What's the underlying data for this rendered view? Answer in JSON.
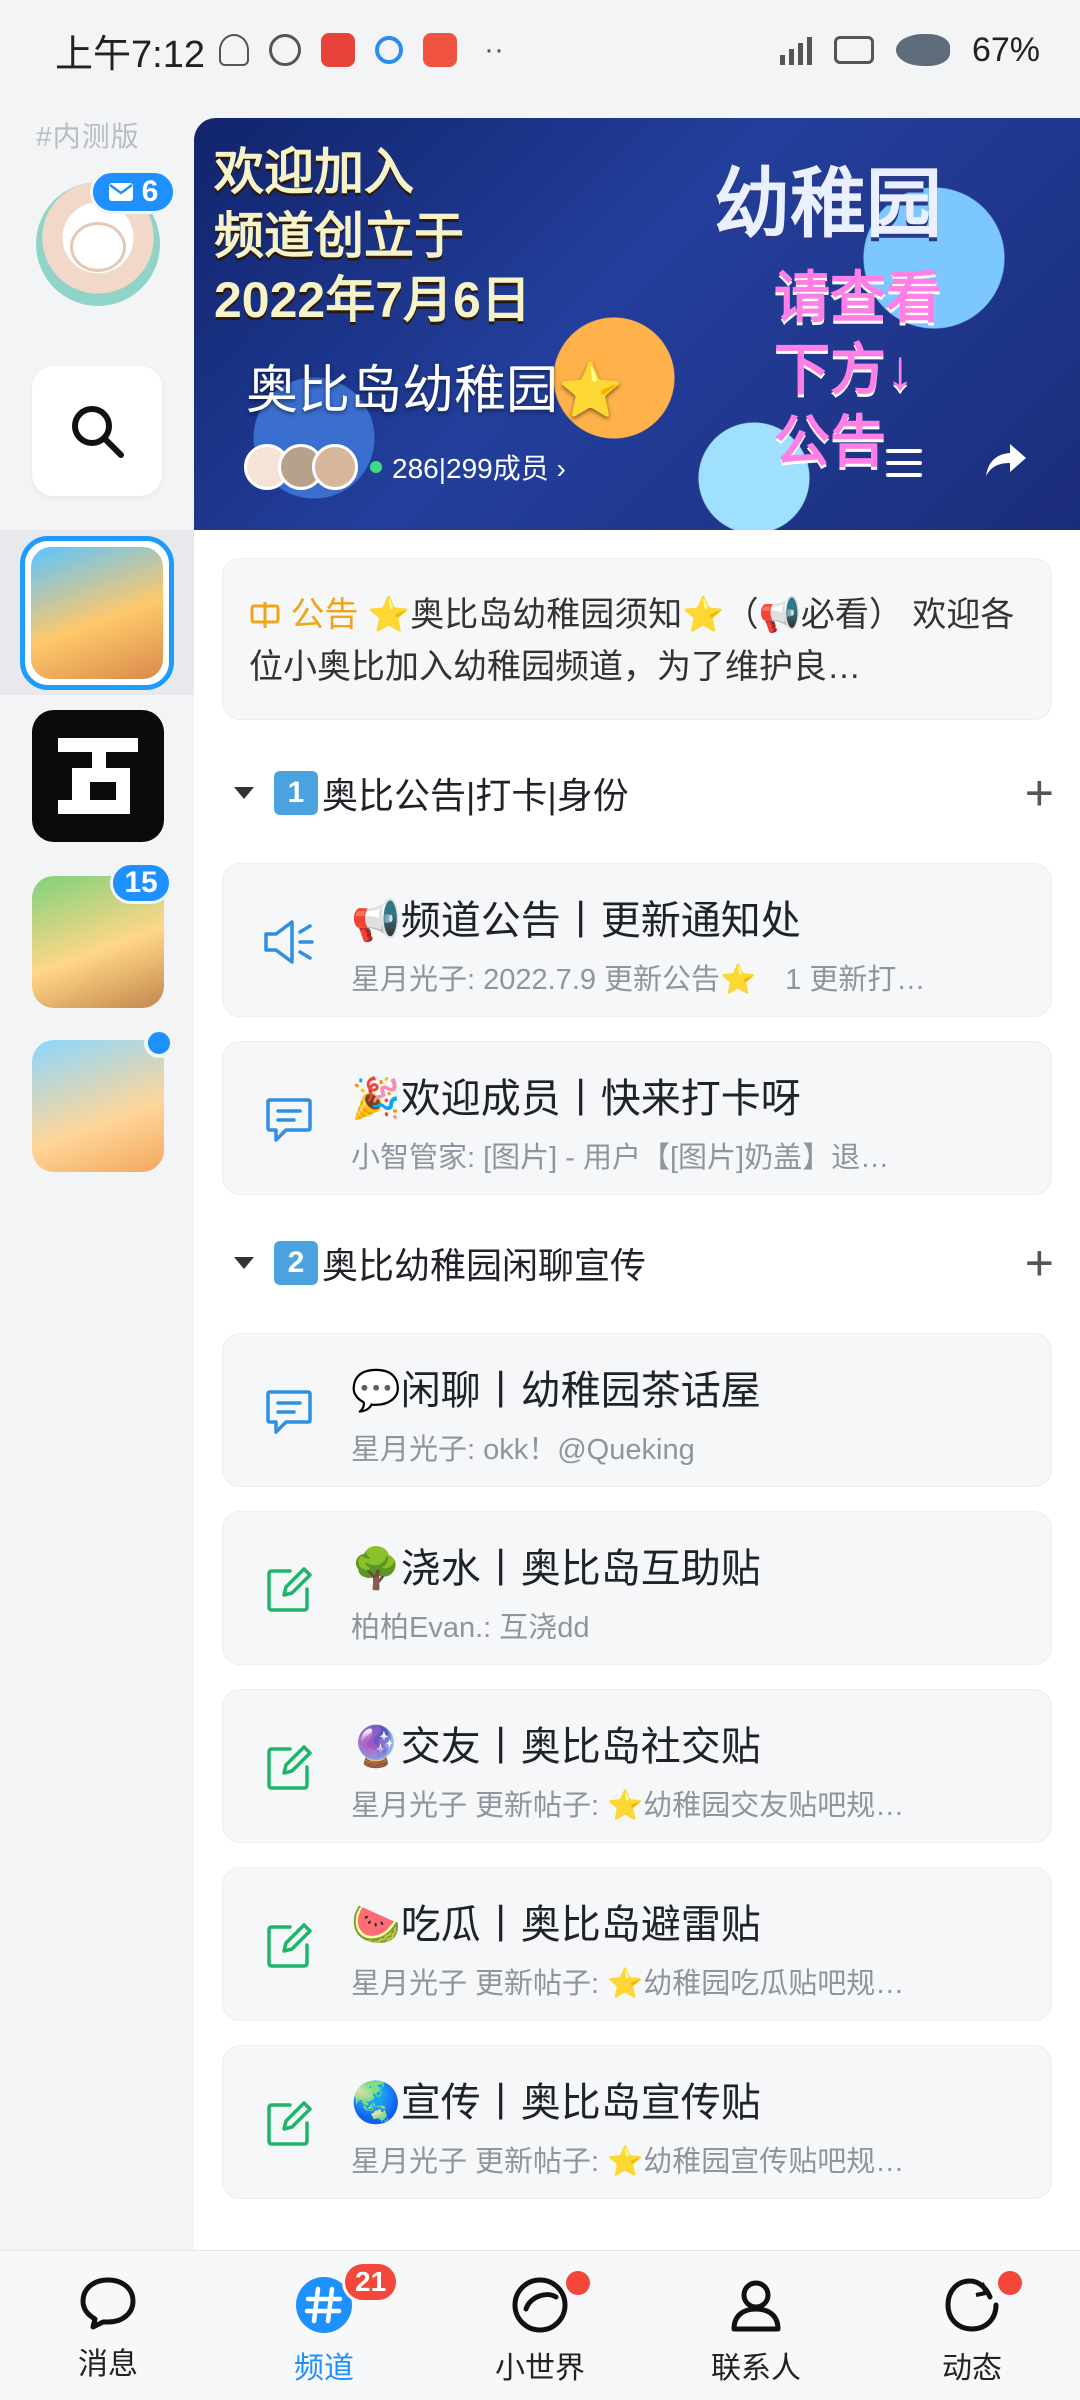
{
  "status_bar": {
    "time": "上午7:12",
    "battery": "67%"
  },
  "sidebar": {
    "beta_label": "#内测版",
    "mail_count": "6",
    "guild_badge_count": "15"
  },
  "banner": {
    "art_left_line1": "欢迎加入",
    "art_left_line2": "频道创立于",
    "art_left_line3": "2022年7月6日",
    "art_right_title": "幼稚园",
    "art_right_note1": "请查看",
    "art_right_note2": "下方↓",
    "art_right_note3": "公告",
    "title": "奥比岛幼稚园⭐",
    "members": "286|299成员 ›"
  },
  "announcement": {
    "tag": "公告",
    "text": "⭐奥比岛幼稚园须知⭐（📢必看） 欢迎各位小奥比加入幼稚园频道，为了维护良…"
  },
  "sections": [
    {
      "title": "奥比公告|打卡|身份",
      "number": "1",
      "channels": [
        {
          "name": "📢频道公告丨更新通知处",
          "preview": "星月光子: 2022.7.9 更新公告⭐　1 更新打…"
        },
        {
          "name": "🎉欢迎成员丨快来打卡呀",
          "preview": "小智管家: [图片]  - 用户【[图片]奶盖】退…"
        }
      ]
    },
    {
      "title": "奥比幼稚园闲聊宣传",
      "number": "2",
      "channels": [
        {
          "name": "💬闲聊丨幼稚园茶话屋",
          "preview": "星月光子: okk！@Queking"
        },
        {
          "name": "🌳浇水丨奥比岛互助贴",
          "preview": "柏柏Evan.: 互浇dd"
        },
        {
          "name": "🔮交友丨奥比岛社交贴",
          "preview": "星月光子 更新帖子: ⭐幼稚园交友贴吧规…"
        },
        {
          "name": "🍉吃瓜丨奥比岛避雷贴",
          "preview": "星月光子 更新帖子: ⭐幼稚园吃瓜贴吧规…"
        },
        {
          "name": "🌏宣传丨奥比岛宣传贴",
          "preview": "星月光子 更新帖子: ⭐幼稚园宣传贴吧规…"
        }
      ]
    }
  ],
  "bottom_nav": [
    {
      "label": "消息"
    },
    {
      "label": "频道",
      "badge": "21"
    },
    {
      "label": "小世界"
    },
    {
      "label": "联系人"
    },
    {
      "label": "动态"
    }
  ],
  "colors": {
    "accent": "#1e90ff",
    "badge_red": "#f4473b",
    "announce_tag": "#f0a419",
    "text_channel_icon": "#2f8fe0",
    "post_channel_icon": "#20b36b"
  }
}
